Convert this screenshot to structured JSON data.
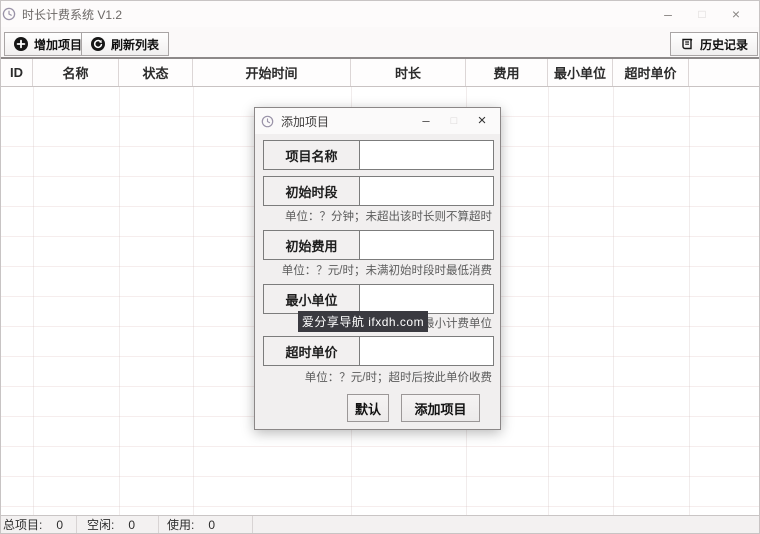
{
  "window": {
    "title": "时长计费系统 V1.2",
    "controls": {
      "minimize": "–",
      "maximize": "□",
      "close": "×"
    }
  },
  "toolbar": {
    "add_label": "增加项目",
    "refresh_label": "刷新列表",
    "history_label": "历史记录"
  },
  "table": {
    "columns": [
      "ID",
      "名称",
      "状态",
      "开始时间",
      "时长",
      "费用",
      "最小单位",
      "超时单价"
    ]
  },
  "status": {
    "items": [
      {
        "label": "总项目:",
        "value": "0"
      },
      {
        "label": "空闲:",
        "value": "0"
      },
      {
        "label": "使用:",
        "value": "0"
      }
    ]
  },
  "dialog": {
    "title": "添加项目",
    "controls": {
      "minimize": "–",
      "maximize": "□",
      "close": "×"
    },
    "rows": [
      {
        "label": "项目名称",
        "value": "",
        "hint": ""
      },
      {
        "label": "初始时段",
        "value": "",
        "hint": "单位：？分钟；未超出该时长则不算超时"
      },
      {
        "label": "初始费用",
        "value": "",
        "hint": "单位：？元/时；未满初始时段时最低消费"
      },
      {
        "label": "最小单位",
        "value": "",
        "hint": "最小计费单位"
      },
      {
        "label": "超时单价",
        "value": "",
        "hint": "单位：？元/时；超时后按此单价收费"
      }
    ],
    "watermark_text": "爱分享导航 ifxdh.com",
    "buttons": {
      "default": "默认",
      "submit": "添加项目"
    }
  },
  "colors": {
    "watermark_bg": "#3a3a40",
    "icon_black": "#161616",
    "toolbar_divider": "#8d8989"
  }
}
